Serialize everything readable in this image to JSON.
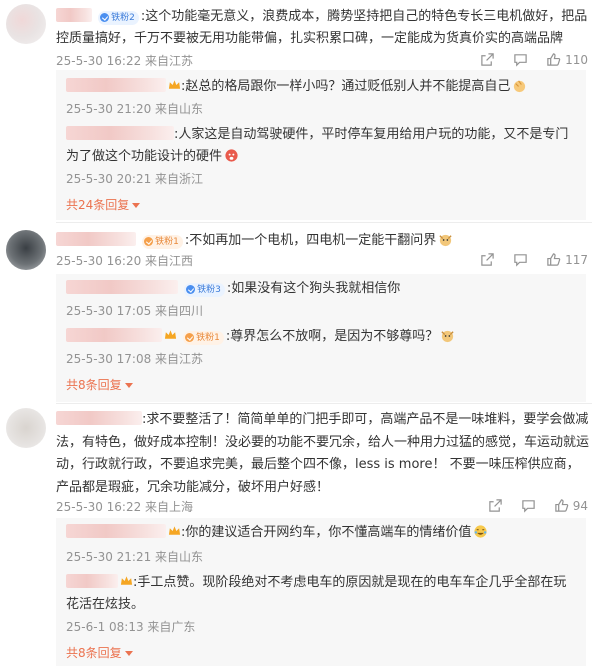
{
  "comments": [
    {
      "badge": "铁粉2",
      "text": "这个功能毫无意义，浪费成本，腾势坚持把自己的特色专长三电机做好，把品控质量搞好，千万不要被无用功能带偏，扎实积累口碑，一定能成为货真价实的高端品牌",
      "meta": "25-5-30 16:22 来自江苏",
      "likes": "110",
      "replies": [
        {
          "text": "赵总的格局跟你一样小吗？通过贬低别人并不能提高自己",
          "meta": "25-5-30 21:20 来自山东"
        },
        {
          "text": "人家这是自动驾驶硬件，平时停车复用给用户玩的功能，又不是专门为了做这个功能设计的硬件",
          "meta": "25-5-30 20:21 来自浙江"
        }
      ],
      "more": "共24条回复"
    },
    {
      "badge": "铁粉1",
      "text": "不如再加一个电机，四电机一定能干翻问界",
      "meta": "25-5-30 16:20 来自江西",
      "likes": "117",
      "replies": [
        {
          "badge": "铁粉3",
          "text": "如果没有这个狗头我就相信你",
          "meta": "25-5-30 17:05 来自四川"
        },
        {
          "badge": "铁粉1",
          "text": "尊界怎么不放啊，是因为不够尊吗？",
          "meta": "25-5-30 17:08 来自江苏"
        }
      ],
      "more": "共8条回复"
    },
    {
      "text": "求不要整活了！简简单单的门把手即可，高端产品不是一味堆料，要学会做减法，有特色，做好成本控制！没必要的功能不要冗余，给人一种用力过猛的感觉，车运动就运动，行政就行政，不要追求完美，最后整个四不像，less is more！ 不要一味压榨供应商，产品都是瑕疵，冗余功能减分，破坏用户好感！",
      "meta": "25-5-30 16:22 来自上海",
      "likes": "94",
      "replies": [
        {
          "text": "你的建议适合开网约车，你不懂高端车的情绪价值",
          "meta": "25-5-30 21:21 来自山东"
        },
        {
          "text": "手工点赞。现阶段绝对不考虑电车的原因就是现在的电车车企几乎全部在玩花活在炫技。",
          "meta": "25-6-1 08:13 来自广东"
        }
      ],
      "more": "共8条回复"
    }
  ],
  "icons": {
    "share": "share-icon",
    "comment": "comment-icon",
    "like": "like-icon"
  },
  "colors": {
    "link": "#eb7350",
    "meta": "#939393",
    "reply_bg": "#f7f7f7",
    "badge": "#3d7cd9"
  }
}
